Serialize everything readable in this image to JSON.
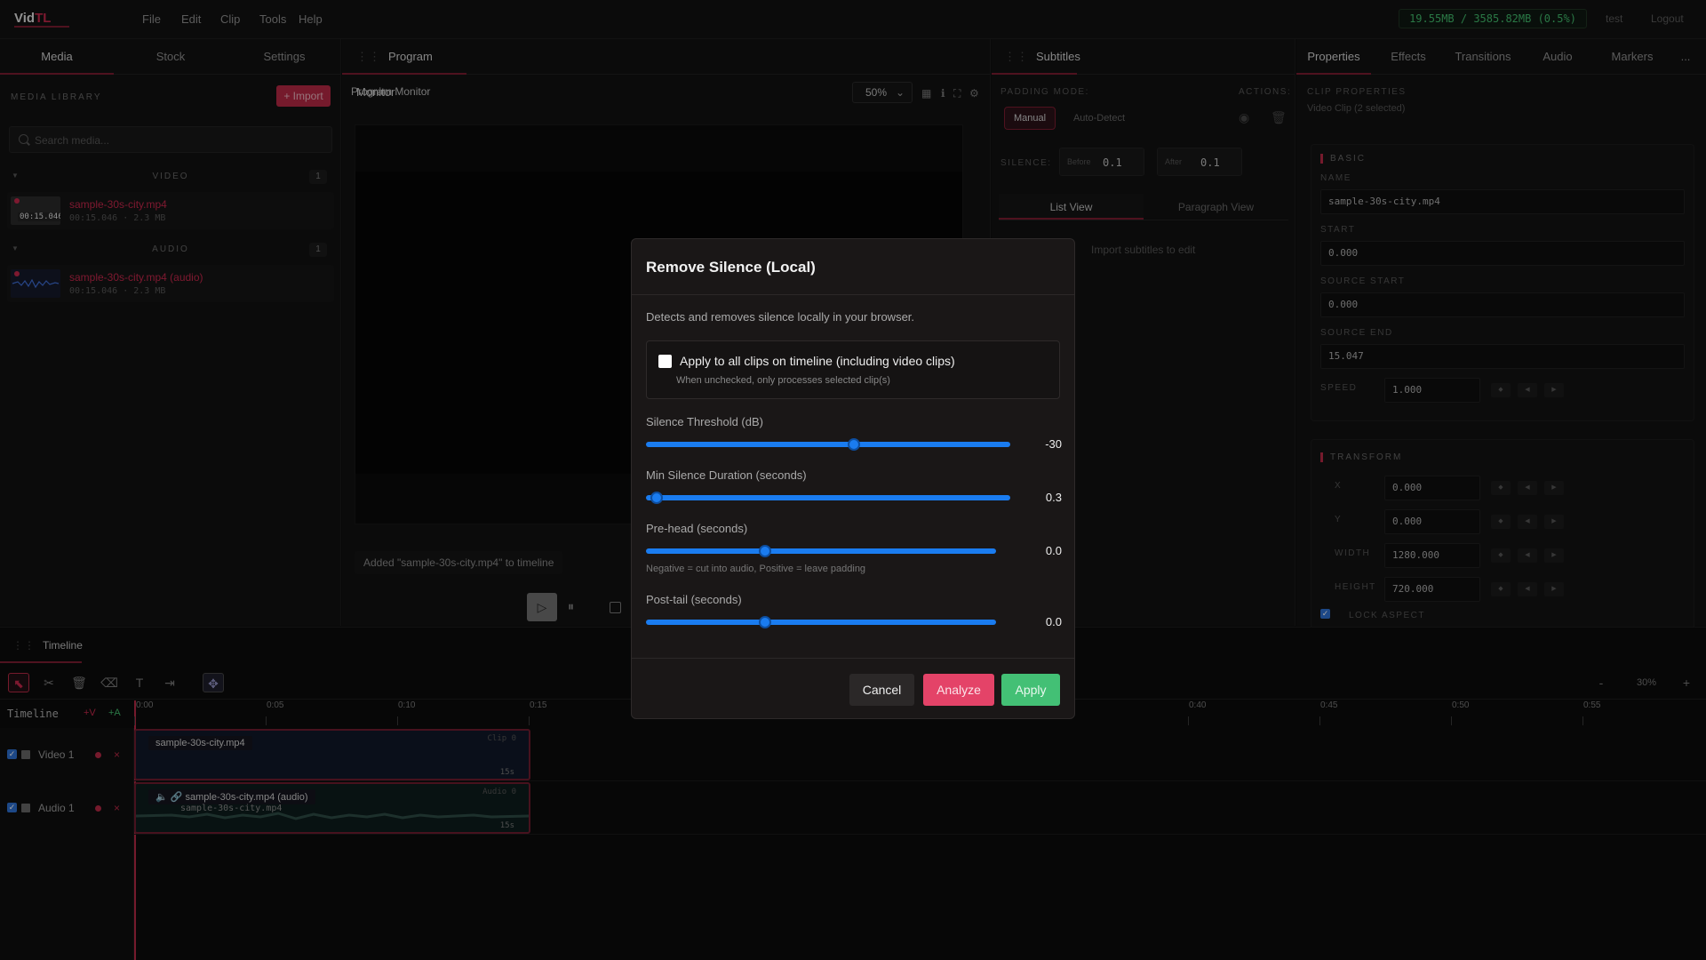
{
  "app": {
    "logo_main": "Vid",
    "logo_accent": "TL",
    "menu": [
      "File",
      "Edit",
      "Clip",
      "Tools",
      "Help"
    ],
    "memory": "19.55MB / 3585.82MB (0.5%)",
    "user": "test",
    "logout": "Logout"
  },
  "left": {
    "tabs": [
      "Media",
      "Stock",
      "Settings"
    ],
    "library_label": "MEDIA LIBRARY",
    "import_label": "+ Import",
    "search_placeholder": "Search media...",
    "groups": [
      {
        "name": "VIDEO",
        "count": "1",
        "item": {
          "name": "sample-30s-city.mp4",
          "meta": "00:15.046 · 2.3 MB",
          "thumb_time": "00:15.046"
        }
      },
      {
        "name": "AUDIO",
        "count": "1",
        "item": {
          "name": "sample-30s-city.mp4 (audio)",
          "meta": "00:15.046 · 2.3 MB"
        }
      }
    ]
  },
  "monitor": {
    "tab": "Program Monitor",
    "title": "Program Monitor",
    "zoom": "50%",
    "status": "Added \"sample-30s-city.mp4\" to timeline",
    "icons": [
      "grid-icon",
      "info-icon",
      "fullscreen-icon",
      "settings-icon"
    ]
  },
  "subtitles": {
    "tab": "Subtitles",
    "padding_mode_label": "PADDING MODE:",
    "actions_label": "ACTIONS:",
    "manual": "Manual",
    "auto_detect": "Auto-Detect",
    "silence_label": "SILENCE:",
    "before_label": "Before",
    "before_value": "0.1",
    "after_label": "After",
    "after_value": "0.1",
    "views": [
      "List View",
      "Paragraph View"
    ],
    "empty": "Import subtitles to edit"
  },
  "properties": {
    "tabs": [
      "Properties",
      "Effects",
      "Transitions",
      "Audio",
      "Markers"
    ],
    "more": "...",
    "clip_props": "CLIP PROPERTIES",
    "clip_sub": "Video Clip (2 selected)",
    "basic": "BASIC",
    "name_label": "NAME",
    "name_value": "sample-30s-city.mp4",
    "start_label": "START",
    "start_value": "0.000",
    "src_start_label": "SOURCE START",
    "src_start_value": "0.000",
    "src_end_label": "SOURCE END",
    "src_end_value": "15.047",
    "speed_label": "SPEED",
    "speed_value": "1.000",
    "transform": "TRANSFORM",
    "x_label": "X",
    "x_value": "0.000",
    "y_label": "Y",
    "y_value": "0.000",
    "width_label": "WIDTH",
    "width_value": "1280.000",
    "height_label": "HEIGHT",
    "height_value": "720.000",
    "lock_aspect": "LOCK ASPECT"
  },
  "timeline": {
    "tab": "Timeline",
    "label": "Timeline",
    "add_video": "+V",
    "add_audio": "+A",
    "zoom_minus": "-",
    "zoom": "30%",
    "zoom_plus": "+",
    "ticks": [
      "0:00",
      "0:05",
      "0:10",
      "0:15",
      "0:40",
      "0:45",
      "0:50",
      "0:55"
    ],
    "tracks": [
      {
        "name": "Video 1",
        "clip": "sample-30s-city.mp4",
        "tag": "Clip 0",
        "dur": "15s"
      },
      {
        "name": "Audio 1",
        "clip": "sample-30s-city.mp4 (audio)",
        "clip_sub": "sample-30s-city.mp4",
        "tag": "Audio 0",
        "dur": "15s"
      }
    ]
  },
  "modal": {
    "title": "Remove Silence (Local)",
    "description": "Detects and removes silence locally in your browser.",
    "apply_all": "Apply to all clips on timeline (including video clips)",
    "apply_all_hint": "When unchecked, only processes selected clip(s)",
    "sliders": [
      {
        "label": "Silence Threshold (dB)",
        "value": "-30",
        "fraction": 0.57
      },
      {
        "label": "Min Silence Duration (seconds)",
        "value": "0.3",
        "fraction": 0.03
      },
      {
        "label": "Pre-head (seconds)",
        "value": "0.0",
        "fraction": 0.34,
        "hint": "Negative = cut into audio, Positive = leave padding"
      },
      {
        "label": "Post-tail (seconds)",
        "value": "0.0",
        "fraction": 0.34
      }
    ],
    "cancel": "Cancel",
    "analyze": "Analyze",
    "apply": "Apply"
  },
  "colors": {
    "accent": "#b42844",
    "slider": "#1a7cf0",
    "apply": "#43c075",
    "analyze": "#e44368"
  }
}
